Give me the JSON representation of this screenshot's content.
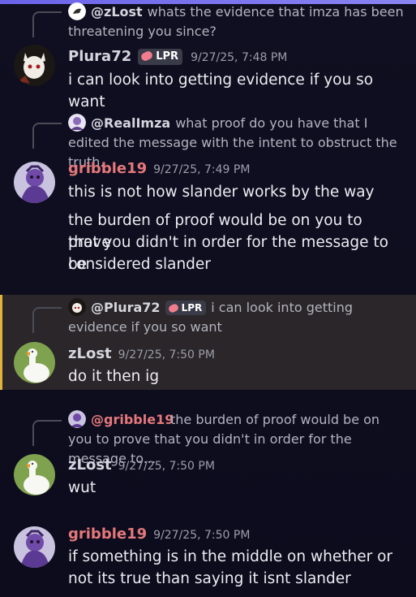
{
  "colors": {
    "background": "#0d0d1c",
    "reply_spine": "#4b4c57",
    "highlight_bg": "#2a2629",
    "highlight_bar": "#e2b33b",
    "author_default": "#d4d5dd",
    "author_gribble": "#e5787b",
    "mention_gribble": "#e5787b",
    "timestamp": "#9c9eab",
    "tag_bg": "#3a3b48"
  },
  "messages": [
    {
      "reply": {
        "user": "@zLost",
        "text": "whats the evidence that imza has been threatening you since?"
      },
      "author": "Plura72",
      "tag": "LPR",
      "timestamp": "9/27/25, 7:48 PM",
      "lines": [
        "i can look into getting evidence if you so want"
      ]
    },
    {
      "reply": {
        "user": "@RealImza",
        "text": "what proof do you have that I edited the message with the intent to obstruct the truth."
      },
      "author": "gribble19",
      "timestamp": "9/27/25, 7:49 PM",
      "lines": [
        "this is not how slander works by the way",
        "the burden of proof would be on you to prove",
        "that you didn't in order for the message to be",
        "considered slander"
      ]
    },
    {
      "highlighted": true,
      "reply": {
        "user": "@Plura72",
        "tag": "LPR",
        "text": "i can look into getting evidence if you so want"
      },
      "author": "zLost",
      "timestamp": "9/27/25, 7:50 PM",
      "lines": [
        "do it then ig"
      ]
    },
    {
      "reply": {
        "user": "@gribble19",
        "text": "the burden of proof would be on you to prove that you didn't in order for the message to..."
      },
      "author": "zLost",
      "timestamp": "9/27/25, 7:50 PM",
      "lines": [
        "wut"
      ]
    },
    {
      "author": "gribble19",
      "timestamp": "9/27/25, 7:50 PM",
      "lines": [
        "if something is in the middle on whether or",
        "not its true than saying it isnt slander"
      ]
    }
  ]
}
